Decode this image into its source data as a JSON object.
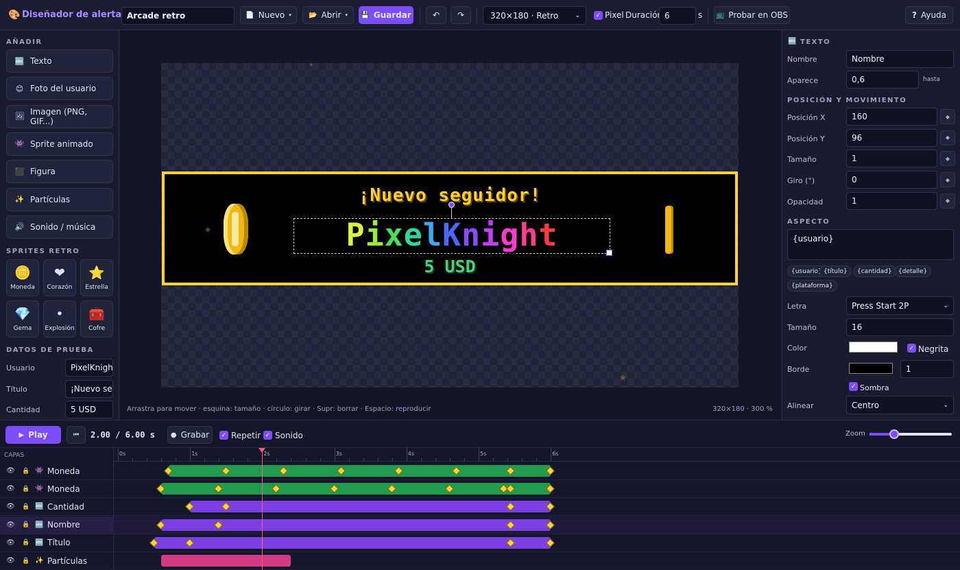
{
  "app": {
    "title": "Diseñador de alertas",
    "palette_icon": "palette-icon"
  },
  "toolbar": {
    "project_name": "Arcade retro",
    "new_label": "Nuevo",
    "open_label": "Abrir",
    "save_label": "Guardar",
    "resolution": "320×180 · Retro",
    "pixel_label": "Pixel",
    "duration_label": "Duración",
    "duration_value": "6",
    "duration_unit": "s",
    "obs_label": "Probar en OBS",
    "help_label": "Ayuda"
  },
  "left": {
    "add_title": "AÑADIR",
    "add_items": [
      {
        "label": "Texto",
        "icon": "text-icon"
      },
      {
        "label": "Foto del usuario",
        "icon": "smiley-icon"
      },
      {
        "label": "Imagen (PNG, GIF...)",
        "icon": "image-icon"
      },
      {
        "label": "Sprite animado",
        "icon": "invader-icon"
      },
      {
        "label": "Figura",
        "icon": "square-icon"
      },
      {
        "label": "Partículas",
        "icon": "sparkles-icon"
      },
      {
        "label": "Sonido / música",
        "icon": "speaker-icon"
      }
    ],
    "sprites_title": "SPRITES RETRO",
    "sprites": [
      {
        "label": "Moneda",
        "icon": "coin-icon"
      },
      {
        "label": "Corazón",
        "icon": "heart-icon"
      },
      {
        "label": "Estrella",
        "icon": "star-icon"
      },
      {
        "label": "Gema",
        "icon": "gem-icon"
      },
      {
        "label": "Explosión",
        "icon": "explosion-icon"
      },
      {
        "label": "Cofre",
        "icon": "chest-icon"
      }
    ],
    "test_title": "DATOS DE PRUEBA",
    "test_fields": [
      {
        "label": "Usuario",
        "value": "PixelKnight"
      },
      {
        "label": "Título",
        "value": "¡Nuevo seguidor!"
      },
      {
        "label": "Cantidad",
        "value": "5 USD"
      }
    ]
  },
  "canvas": {
    "title_text": "¡Nuevo seguidor!",
    "name_letters": [
      "P",
      "i",
      "x",
      "e",
      "l",
      "K",
      "n",
      "i",
      "g",
      "h",
      "t"
    ],
    "name_colors": [
      "#d8f53b",
      "#95ee3a",
      "#45e25a",
      "#2fd6a4",
      "#3aaaf6",
      "#4a68ff",
      "#8a4bff",
      "#c43dff",
      "#ff38d4",
      "#ff3c8e",
      "#ff3b3b"
    ],
    "amount_text": "5 USD",
    "hint": "Arrastra para mover · esquina: tamaño · círculo: girar · Supr: borrar · Espacio: reproducir",
    "status": "320×180 · 300 %",
    "colors": {
      "border": "#ffd23f",
      "coin": "#f2b712",
      "amount": "#49d17a"
    }
  },
  "right": {
    "title": "TEXTO",
    "name_label": "Nombre",
    "name_value": "Nombre",
    "appear_label": "Aparece",
    "appear_value": "0,6",
    "until_label": "hasta",
    "pos_title": "POSICIÓN Y MOVIMIENTO",
    "pos_fields": [
      {
        "label": "Posición X",
        "value": "160"
      },
      {
        "label": "Posición Y",
        "value": "96"
      },
      {
        "label": "Tamaño",
        "value": "1"
      },
      {
        "label": "Giro (°)",
        "value": "0"
      },
      {
        "label": "Opacidad",
        "value": "1"
      }
    ],
    "look_title": "ASPECTO",
    "text_value": "{usuario}",
    "tags": [
      "{usuario}",
      "{título}",
      "{cantidad}",
      "{detalle}",
      "{plataforma}"
    ],
    "font_label": "Letra",
    "font_value": "Press Start 2P",
    "size_label": "Tamaño",
    "size_value": "16",
    "color_label": "Color",
    "bold_label": "Negrita",
    "border_label": "Borde",
    "border_value": "1",
    "shadow_label": "Sombra",
    "align_label": "Alinear",
    "align_value": "Centro"
  },
  "timeline": {
    "play_label": "Play",
    "time_text": "2.00 / 6.00 s",
    "record_label": "Grabar",
    "loop_label": "Repetir",
    "sound_label": "Sonido",
    "zoom_label": "Zoom",
    "zoom_value": 0.3,
    "layers_header": "CAPAS",
    "ticks": [
      "0s",
      "1s",
      "2s",
      "3s",
      "4s",
      "5s",
      "6s"
    ],
    "playhead_seconds": 2.0,
    "layers": [
      {
        "name": "Moneda",
        "icon": "invader-icon",
        "color": "#1f9c4e",
        "start": 0.7,
        "end": 6.0,
        "keys": [
          0.7,
          1.5,
          2.3,
          3.1,
          3.9,
          4.7,
          5.45,
          6.0
        ]
      },
      {
        "name": "Moneda",
        "icon": "invader-icon",
        "color": "#1f9c4e",
        "start": 0.6,
        "end": 6.0,
        "keys": [
          0.6,
          1.4,
          2.2,
          3.0,
          3.8,
          4.6,
          5.35,
          5.45,
          6.0
        ]
      },
      {
        "name": "Cantidad",
        "icon": "text-icon",
        "color": "#7b3fe4",
        "start": 1.0,
        "end": 6.0,
        "keys": [
          1.0,
          1.5,
          5.45,
          6.0
        ]
      },
      {
        "name": "Nombre",
        "icon": "text-icon",
        "color": "#7b3fe4",
        "start": 0.6,
        "end": 6.0,
        "keys": [
          0.6,
          1.4,
          5.45,
          6.0
        ],
        "selected": true
      },
      {
        "name": "Título",
        "icon": "text-icon",
        "color": "#7b3fe4",
        "start": 0.5,
        "end": 6.0,
        "keys": [
          0.5,
          1.0,
          5.45,
          6.0
        ]
      },
      {
        "name": "Partículas",
        "icon": "sparkles-icon",
        "color": "#d43a86",
        "start": 0.6,
        "end": 2.4,
        "keys": []
      }
    ]
  }
}
